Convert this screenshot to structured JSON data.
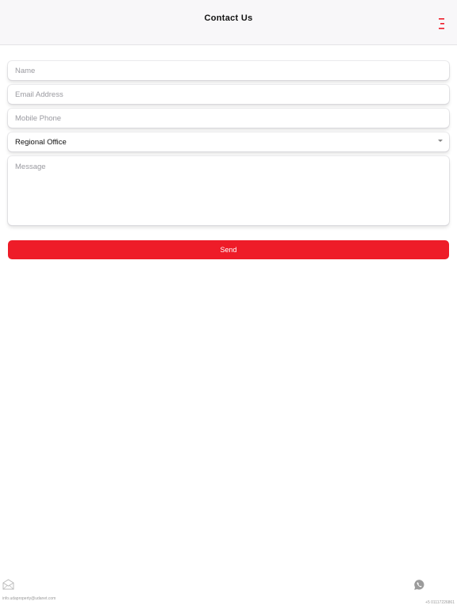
{
  "header": {
    "title": "Contact Us",
    "menu_icon": "hamburger-menu-icon",
    "accent_color": "#ee1c28"
  },
  "form": {
    "name_placeholder": "Name",
    "email_placeholder": "Email Address",
    "mobile_placeholder": "Mobile Phone",
    "office_select_value": "Regional Office",
    "message_placeholder": "Message",
    "send_label": "Send",
    "send_color": "#ee1c28"
  },
  "footer": {
    "email": "info.udaproperty@udanet.com",
    "phone": "+5 01117226861",
    "email_icon": "envelope-icon",
    "phone_icon": "whatsapp-icon"
  }
}
